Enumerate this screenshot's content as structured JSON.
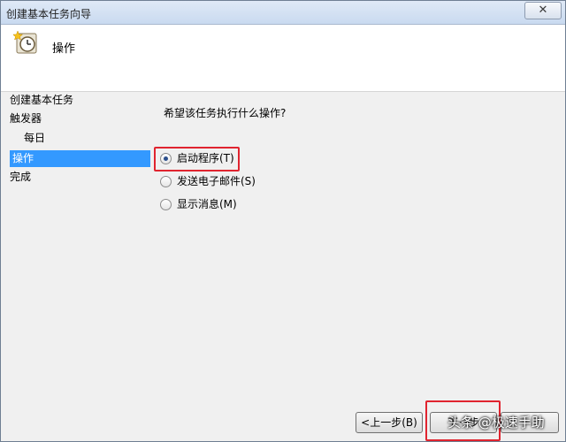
{
  "window": {
    "title": "创建基本任务向导",
    "close_label": "✕"
  },
  "header": {
    "title": "操作",
    "icon": "task-scheduler-clock-icon"
  },
  "sidebar": {
    "items": [
      {
        "label": "创建基本任务",
        "active": false
      },
      {
        "label": "触发器",
        "active": false
      },
      {
        "label": "每日",
        "active": false
      },
      {
        "label": "操作",
        "active": true
      },
      {
        "label": "完成",
        "active": false
      }
    ]
  },
  "main": {
    "prompt": "希望该任务执行什么操作?",
    "options": [
      {
        "label": "启动程序(T)",
        "selected": true
      },
      {
        "label": "发送电子邮件(S)",
        "selected": false
      },
      {
        "label": "显示消息(M)",
        "selected": false
      }
    ]
  },
  "buttons": {
    "back": "<上一步(B)",
    "next": "下一步",
    "cancel": ""
  },
  "watermark": "头条 @极速手助",
  "colors": {
    "highlight": "#e0242f",
    "selection": "#3399ff"
  }
}
